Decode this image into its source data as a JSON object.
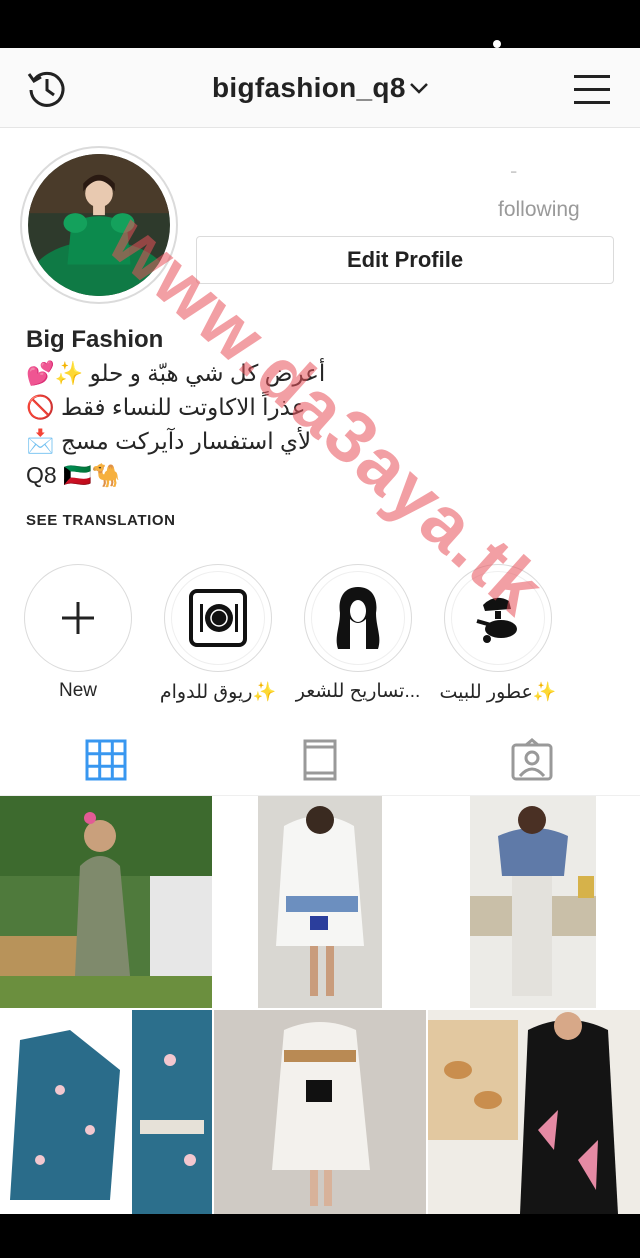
{
  "header": {
    "username": "bigfashion_q8"
  },
  "profile": {
    "stat_hint": "-",
    "following_label": "following",
    "edit_button": "Edit Profile",
    "name": "Big Fashion",
    "bio_lines": [
      {
        "text": "أعرض كل شي هبّة و حلو",
        "emoji": "💕✨"
      },
      {
        "text": "عذراً الاكاوتت للنساء فقط",
        "emoji": "🚫"
      },
      {
        "text": "لأي استفسار دآيركت مسج",
        "emoji": "📩"
      },
      {
        "text": "Q8",
        "emoji": "🇰🇼🐪"
      }
    ],
    "see_translation": "SEE TRANSLATION"
  },
  "highlights": [
    {
      "label": "New",
      "icon": "plus-icon"
    },
    {
      "label": "ريوق للدوام✨",
      "icon": "plate-icon"
    },
    {
      "label": "تساريح للشعر...",
      "icon": "hair-icon"
    },
    {
      "label": "عطور للبيت✨",
      "icon": "perfume-icon"
    }
  ],
  "tabs": [
    {
      "name": "grid-tab",
      "active": true
    },
    {
      "name": "feed-tab",
      "active": false
    },
    {
      "name": "tagged-tab",
      "active": false
    }
  ],
  "posts_count": 6,
  "watermark": "www.da3aya.tk",
  "colors": {
    "accent": "#3897f0",
    "border": "#dbdbdb",
    "watermark": "#e8505a"
  }
}
